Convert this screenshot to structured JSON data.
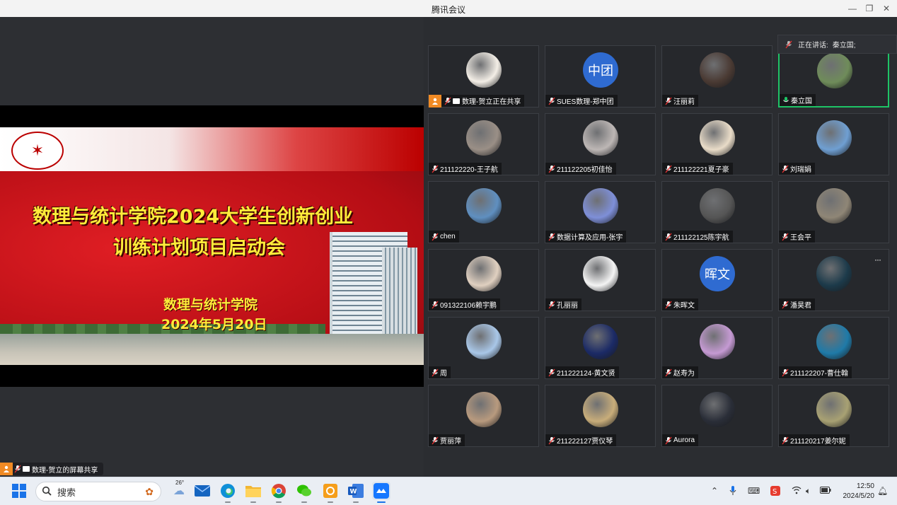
{
  "window": {
    "title": "腾讯会议"
  },
  "slide": {
    "title_line1": "数理与统计学院2024大学生创新创业",
    "title_line2": "训练计划项目启动会",
    "org": "数理与统计学院",
    "date": "2024年5月20日"
  },
  "share_label": "数理-贺立的屏幕共享",
  "speaking": {
    "label": "正在讲话:",
    "name": "秦立国;"
  },
  "participants": [
    {
      "name": "数理-贺立正在共享",
      "avatar_text": "",
      "color": "#f3eee6",
      "sharing": true
    },
    {
      "name": "SUES数理-郑中团",
      "avatar_text": "中团",
      "color": "#2f6bd1"
    },
    {
      "name": "汪丽莉",
      "avatar_text": "",
      "color": "#4a3a33"
    },
    {
      "name": "秦立国",
      "avatar_text": "",
      "color": "#6f8c5a",
      "active": true
    },
    {
      "name": "211122220-王子航",
      "avatar_text": "",
      "color": "#9a8f86"
    },
    {
      "name": "211122205初佳怡",
      "avatar_text": "",
      "color": "#bdb7b5"
    },
    {
      "name": "211122221夏子豪",
      "avatar_text": "",
      "color": "#e9dcc8"
    },
    {
      "name": "刘瑞娟",
      "avatar_text": "",
      "color": "#6f9fd2"
    },
    {
      "name": "chen",
      "avatar_text": "",
      "color": "#5f8fc0"
    },
    {
      "name": "数据计算及应用-张宇",
      "avatar_text": "",
      "color": "#7e8fd8"
    },
    {
      "name": "211122125陈宇航",
      "avatar_text": "",
      "color": "#555555"
    },
    {
      "name": "王会平",
      "avatar_text": "",
      "color": "#8f8676"
    },
    {
      "name": "091322106赖宇鹏",
      "avatar_text": "",
      "color": "#e0d0c0"
    },
    {
      "name": "孔丽丽",
      "avatar_text": "",
      "color": "#f4f4f4"
    },
    {
      "name": "朱晖文",
      "avatar_text": "晖文",
      "color": "#2f6bd1"
    },
    {
      "name": "潘昊君",
      "avatar_text": "",
      "color": "#1c3a4a"
    },
    {
      "name": "周",
      "avatar_text": "",
      "color": "#a9c7e8"
    },
    {
      "name": "211222124-黄文贤",
      "avatar_text": "",
      "color": "#1b2a66"
    },
    {
      "name": "赵寿为",
      "avatar_text": "",
      "color": "#c59ad3"
    },
    {
      "name": "211122207-曹仕翰",
      "avatar_text": "",
      "color": "#1f7aa8"
    },
    {
      "name": "贾丽萍",
      "avatar_text": "",
      "color": "#b89a7e"
    },
    {
      "name": "211222127贾仪琴",
      "avatar_text": "",
      "color": "#c8ad7a"
    },
    {
      "name": "Aurora",
      "avatar_text": "",
      "color": "#2a2e38"
    },
    {
      "name": "211120217姜尔妮",
      "avatar_text": "",
      "color": "#a8a173"
    }
  ],
  "more_button": "···",
  "taskbar": {
    "search_placeholder": "搜索",
    "weather_temp": "26°",
    "time": "12:50",
    "date": "2024/5/20"
  },
  "colors": {
    "accent_green": "#1ec466",
    "share_orange": "#f08a24"
  }
}
